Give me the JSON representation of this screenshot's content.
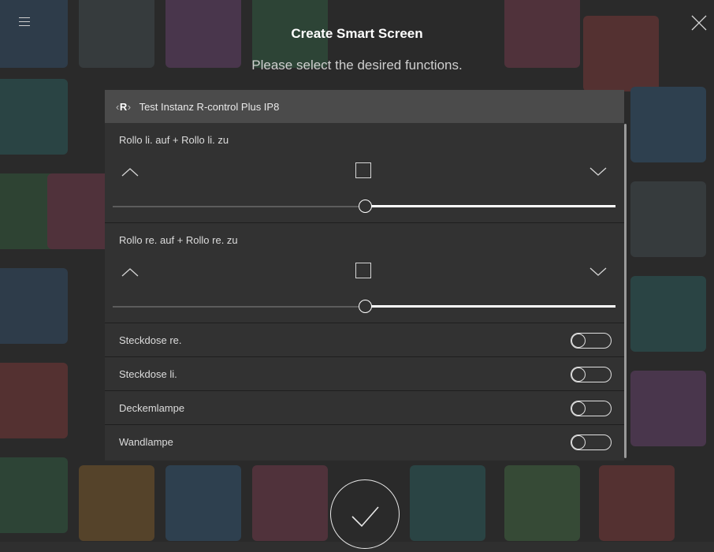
{
  "header": {
    "title": "Create Smart Screen",
    "subtitle": "Please select the desired functions."
  },
  "device": {
    "logo_text": "R",
    "name": "Test Instanz R-control Plus IP8"
  },
  "shutters": [
    {
      "label": "Rollo li. auf + Rollo li. zu",
      "position_fraction": 0.5
    },
    {
      "label": "Rollo re. auf + Rollo re. zu",
      "position_fraction": 0.5
    }
  ],
  "switches": [
    {
      "label": "Steckdose re.",
      "on": false
    },
    {
      "label": "Steckdose li.",
      "on": false
    },
    {
      "label": "Deckemlampe",
      "on": false
    },
    {
      "label": "Wandlampe",
      "on": false
    }
  ],
  "icons": {
    "menu": "hamburger-menu-icon",
    "close": "close-icon",
    "up": "chevron-up-icon",
    "stop": "stop-square-icon",
    "down": "chevron-down-icon",
    "confirm": "checkmark-icon"
  },
  "colors": {
    "panel": "#323232",
    "header_bar": "#4b4b4b",
    "accent": "#ffffff"
  }
}
